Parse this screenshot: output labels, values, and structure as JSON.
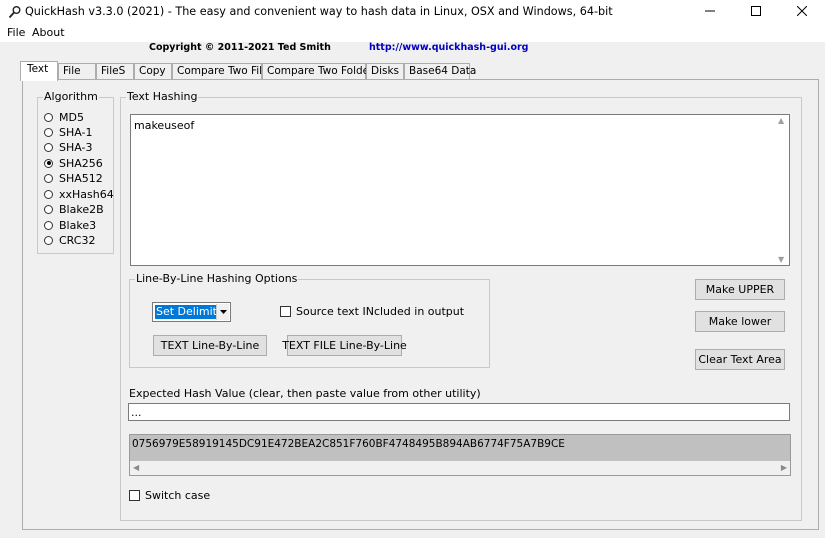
{
  "window": {
    "title": "QuickHash v3.3.0 (2021) - The easy and convenient way to hash data in Linux, OSX and Windows, 64-bit"
  },
  "menu": {
    "items": [
      "File",
      "About"
    ]
  },
  "header": {
    "copyright": "Copyright © 2011-2021  Ted Smith",
    "url": "http://www.quickhash-gui.org"
  },
  "tabs": [
    "Text",
    "File",
    "FileS",
    "Copy",
    "Compare Two Files",
    "Compare Two Folders",
    "Disks",
    "Base64 Data"
  ],
  "active_tab": "Text",
  "algorithm": {
    "label": "Algorithm",
    "options": [
      "MD5",
      "SHA-1",
      "SHA-3",
      "SHA256",
      "SHA512",
      "xxHash64",
      "Blake2B",
      "Blake3",
      "CRC32"
    ],
    "selected": "SHA256"
  },
  "text_hashing": {
    "label": "Text Hashing",
    "input_value": "makeuseof"
  },
  "line_by_line": {
    "label": "Line-By-Line Hashing Options",
    "delimiter_value": "Set Delimiter",
    "source_checkbox_label": "Source text INcluded in output",
    "text_button": "TEXT Line-By-Line",
    "file_button": "TEXT FILE Line-By-Line"
  },
  "side_buttons": {
    "upper": "Make UPPER",
    "lower": "Make lower",
    "clear": "Clear Text Area"
  },
  "expected": {
    "label": "Expected Hash Value (clear, then paste value from other utility)",
    "value": "..."
  },
  "result": {
    "hash": "0756979E58919145DC91E472BEA2C851F760BF4748495B894AB6774F75A7B9CE"
  },
  "switch_case_label": "Switch case"
}
